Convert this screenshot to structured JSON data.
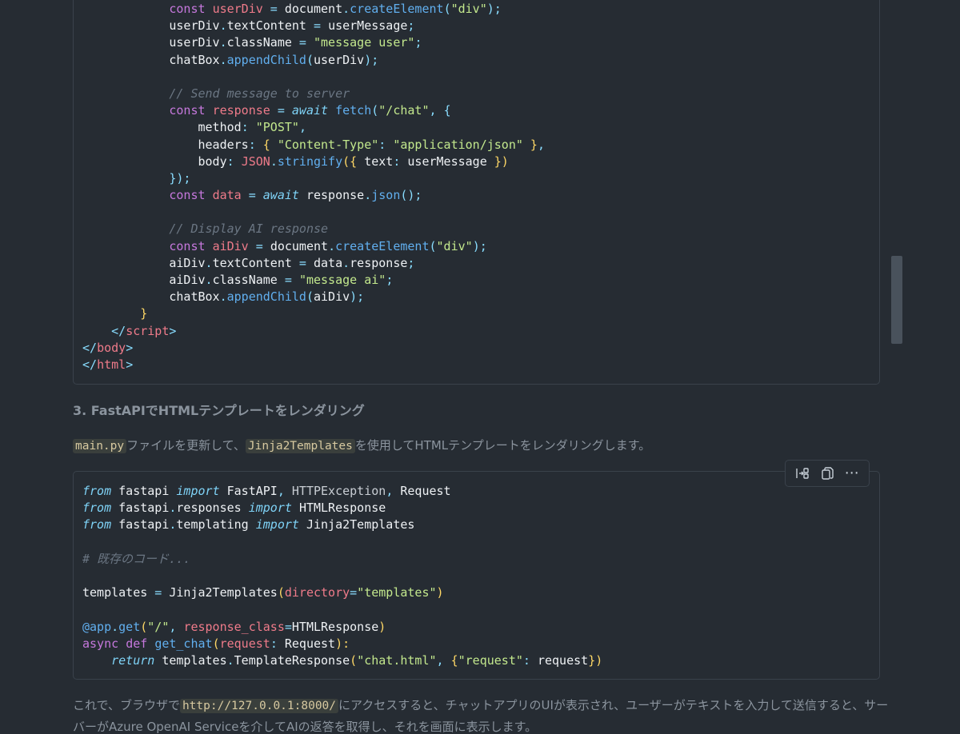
{
  "code_block_1": {
    "lines": [
      [
        [
          "            ",
          "tk-default"
        ],
        [
          "const ",
          "tk-keyword"
        ],
        [
          "userDiv",
          "tk-var"
        ],
        [
          " = ",
          "tk-punct"
        ],
        [
          "document",
          "tk-default"
        ],
        [
          ".",
          "tk-punct"
        ],
        [
          "createElement",
          "tk-func"
        ],
        [
          "(",
          "tk-punct"
        ],
        [
          "\"div\"",
          "tk-string"
        ],
        [
          ");",
          "tk-punct"
        ]
      ],
      [
        [
          "            ",
          "tk-default"
        ],
        [
          "userDiv",
          "tk-default"
        ],
        [
          ".",
          "tk-punct"
        ],
        [
          "textContent",
          "tk-default"
        ],
        [
          " = ",
          "tk-punct"
        ],
        [
          "userMessage",
          "tk-default"
        ],
        [
          ";",
          "tk-punct"
        ]
      ],
      [
        [
          "            ",
          "tk-default"
        ],
        [
          "userDiv",
          "tk-default"
        ],
        [
          ".",
          "tk-punct"
        ],
        [
          "className",
          "tk-default"
        ],
        [
          " = ",
          "tk-punct"
        ],
        [
          "\"message user\"",
          "tk-string"
        ],
        [
          ";",
          "tk-punct"
        ]
      ],
      [
        [
          "            ",
          "tk-default"
        ],
        [
          "chatBox",
          "tk-default"
        ],
        [
          ".",
          "tk-punct"
        ],
        [
          "appendChild",
          "tk-func"
        ],
        [
          "(",
          "tk-punct"
        ],
        [
          "userDiv",
          "tk-default"
        ],
        [
          ");",
          "tk-punct"
        ]
      ],
      [
        [
          "",
          "tk-default"
        ]
      ],
      [
        [
          "            ",
          "tk-default"
        ],
        [
          "// Send message to server",
          "tk-comment"
        ]
      ],
      [
        [
          "            ",
          "tk-default"
        ],
        [
          "const ",
          "tk-keyword"
        ],
        [
          "response",
          "tk-var"
        ],
        [
          " = ",
          "tk-punct"
        ],
        [
          "await ",
          "tk-italic-kw"
        ],
        [
          "fetch",
          "tk-func"
        ],
        [
          "(",
          "tk-punct"
        ],
        [
          "\"/chat\"",
          "tk-string"
        ],
        [
          ", ",
          "tk-punct"
        ],
        [
          "{",
          "tk-punct"
        ]
      ],
      [
        [
          "                ",
          "tk-default"
        ],
        [
          "method",
          "tk-default"
        ],
        [
          ": ",
          "tk-punct"
        ],
        [
          "\"POST\"",
          "tk-string"
        ],
        [
          ",",
          "tk-punct"
        ]
      ],
      [
        [
          "                ",
          "tk-default"
        ],
        [
          "headers",
          "tk-default"
        ],
        [
          ": ",
          "tk-punct"
        ],
        [
          "{ ",
          "tk-brace"
        ],
        [
          "\"Content-Type\"",
          "tk-string"
        ],
        [
          ": ",
          "tk-punct"
        ],
        [
          "\"application/json\"",
          "tk-string"
        ],
        [
          " }",
          "tk-brace"
        ],
        [
          ",",
          "tk-punct"
        ]
      ],
      [
        [
          "                ",
          "tk-default"
        ],
        [
          "body",
          "tk-default"
        ],
        [
          ": ",
          "tk-punct"
        ],
        [
          "JSON",
          "tk-const"
        ],
        [
          ".",
          "tk-punct"
        ],
        [
          "stringify",
          "tk-func"
        ],
        [
          "({ ",
          "tk-brace"
        ],
        [
          "text",
          "tk-default"
        ],
        [
          ": ",
          "tk-punct"
        ],
        [
          "userMessage",
          "tk-default"
        ],
        [
          " })",
          "tk-brace"
        ]
      ],
      [
        [
          "            ",
          "tk-default"
        ],
        [
          "});",
          "tk-punct"
        ]
      ],
      [
        [
          "            ",
          "tk-default"
        ],
        [
          "const ",
          "tk-keyword"
        ],
        [
          "data",
          "tk-var"
        ],
        [
          " = ",
          "tk-punct"
        ],
        [
          "await ",
          "tk-italic-kw"
        ],
        [
          "response",
          "tk-default"
        ],
        [
          ".",
          "tk-punct"
        ],
        [
          "json",
          "tk-func"
        ],
        [
          "();",
          "tk-punct"
        ]
      ],
      [
        [
          "",
          "tk-default"
        ]
      ],
      [
        [
          "            ",
          "tk-default"
        ],
        [
          "// Display AI response",
          "tk-comment"
        ]
      ],
      [
        [
          "            ",
          "tk-default"
        ],
        [
          "const ",
          "tk-keyword"
        ],
        [
          "aiDiv",
          "tk-var"
        ],
        [
          " = ",
          "tk-punct"
        ],
        [
          "document",
          "tk-default"
        ],
        [
          ".",
          "tk-punct"
        ],
        [
          "createElement",
          "tk-func"
        ],
        [
          "(",
          "tk-punct"
        ],
        [
          "\"div\"",
          "tk-string"
        ],
        [
          ");",
          "tk-punct"
        ]
      ],
      [
        [
          "            ",
          "tk-default"
        ],
        [
          "aiDiv",
          "tk-default"
        ],
        [
          ".",
          "tk-punct"
        ],
        [
          "textContent",
          "tk-default"
        ],
        [
          " = ",
          "tk-punct"
        ],
        [
          "data",
          "tk-default"
        ],
        [
          ".",
          "tk-punct"
        ],
        [
          "response",
          "tk-default"
        ],
        [
          ";",
          "tk-punct"
        ]
      ],
      [
        [
          "            ",
          "tk-default"
        ],
        [
          "aiDiv",
          "tk-default"
        ],
        [
          ".",
          "tk-punct"
        ],
        [
          "className",
          "tk-default"
        ],
        [
          " = ",
          "tk-punct"
        ],
        [
          "\"message ai\"",
          "tk-string"
        ],
        [
          ";",
          "tk-punct"
        ]
      ],
      [
        [
          "            ",
          "tk-default"
        ],
        [
          "chatBox",
          "tk-default"
        ],
        [
          ".",
          "tk-punct"
        ],
        [
          "appendChild",
          "tk-func"
        ],
        [
          "(",
          "tk-punct"
        ],
        [
          "aiDiv",
          "tk-default"
        ],
        [
          ");",
          "tk-punct"
        ]
      ],
      [
        [
          "        ",
          "tk-default"
        ],
        [
          "}",
          "tk-brace"
        ]
      ],
      [
        [
          "    ",
          "tk-default"
        ],
        [
          "</",
          "tk-punct"
        ],
        [
          "script",
          "tk-tag"
        ],
        [
          ">",
          "tk-punct"
        ]
      ],
      [
        [
          "",
          "tk-default"
        ],
        [
          "</",
          "tk-punct"
        ],
        [
          "body",
          "tk-tag"
        ],
        [
          ">",
          "tk-punct"
        ]
      ],
      [
        [
          "",
          "tk-default"
        ],
        [
          "</",
          "tk-punct"
        ],
        [
          "html",
          "tk-tag"
        ],
        [
          ">",
          "tk-punct"
        ]
      ]
    ]
  },
  "section_heading": "3. FastAPIでHTMLテンプレートをレンダリング",
  "paragraph_1": {
    "code_1": "main.py",
    "text_1": "ファイルを更新して、",
    "code_2": "Jinja2Templates",
    "text_2": "を使用してHTMLテンプレートをレンダリングします。"
  },
  "toolbar": {
    "wrap_icon": "wrap-lines-icon",
    "copy_icon": "copy-icon",
    "more_icon": "more-icon",
    "more_label": "⋯"
  },
  "code_block_2": {
    "lines": [
      [
        [
          "from ",
          "tk-italic-kw"
        ],
        [
          "fastapi ",
          "tk-default"
        ],
        [
          "import ",
          "tk-italic-kw"
        ],
        [
          "FastAPI",
          "tk-default"
        ],
        [
          ", ",
          "tk-punct"
        ],
        [
          "HTTPException",
          "tk-muted"
        ],
        [
          ", ",
          "tk-punct"
        ],
        [
          "Request",
          "tk-default"
        ]
      ],
      [
        [
          "from ",
          "tk-italic-kw"
        ],
        [
          "fastapi",
          "tk-default"
        ],
        [
          ".",
          "tk-punct"
        ],
        [
          "responses ",
          "tk-default"
        ],
        [
          "import ",
          "tk-italic-kw"
        ],
        [
          "HTMLResponse",
          "tk-default"
        ]
      ],
      [
        [
          "from ",
          "tk-italic-kw"
        ],
        [
          "fastapi",
          "tk-default"
        ],
        [
          ".",
          "tk-punct"
        ],
        [
          "templating ",
          "tk-default"
        ],
        [
          "import ",
          "tk-italic-kw"
        ],
        [
          "Jinja2Templates",
          "tk-default"
        ]
      ],
      [
        [
          "",
          "tk-default"
        ]
      ],
      [
        [
          "# 既存のコード...",
          "tk-comment"
        ]
      ],
      [
        [
          "",
          "tk-default"
        ]
      ],
      [
        [
          "templates",
          "tk-default"
        ],
        [
          " = ",
          "tk-punct"
        ],
        [
          "Jinja2Templates",
          "tk-default"
        ],
        [
          "(",
          "tk-brace"
        ],
        [
          "directory",
          "tk-var"
        ],
        [
          "=",
          "tk-punct"
        ],
        [
          "\"templates\"",
          "tk-string"
        ],
        [
          ")",
          "tk-brace"
        ]
      ],
      [
        [
          "",
          "tk-default"
        ]
      ],
      [
        [
          "@app",
          "tk-func"
        ],
        [
          ".",
          "tk-punct"
        ],
        [
          "get",
          "tk-func"
        ],
        [
          "(",
          "tk-brace"
        ],
        [
          "\"/\"",
          "tk-string"
        ],
        [
          ", ",
          "tk-punct"
        ],
        [
          "response_class",
          "tk-var"
        ],
        [
          "=",
          "tk-punct"
        ],
        [
          "HTMLResponse",
          "tk-default"
        ],
        [
          ")",
          "tk-brace"
        ]
      ],
      [
        [
          "async ",
          "tk-keyword"
        ],
        [
          "def ",
          "tk-keyword"
        ],
        [
          "get_chat",
          "tk-func"
        ],
        [
          "(",
          "tk-brace"
        ],
        [
          "request",
          "tk-var"
        ],
        [
          ": ",
          "tk-punct"
        ],
        [
          "Request",
          "tk-default"
        ],
        [
          "):",
          "tk-brace"
        ]
      ],
      [
        [
          "    ",
          "tk-default"
        ],
        [
          "return ",
          "tk-italic-kw"
        ],
        [
          "templates",
          "tk-default"
        ],
        [
          ".",
          "tk-punct"
        ],
        [
          "TemplateResponse",
          "tk-default"
        ],
        [
          "(",
          "tk-brace"
        ],
        [
          "\"chat.html\"",
          "tk-string"
        ],
        [
          ", ",
          "tk-punct"
        ],
        [
          "{",
          "tk-brace"
        ],
        [
          "\"request\"",
          "tk-string"
        ],
        [
          ": ",
          "tk-punct"
        ],
        [
          "request",
          "tk-default"
        ],
        [
          "})",
          "tk-brace"
        ]
      ]
    ]
  },
  "paragraph_2": {
    "text_1": "これで、ブラウザで",
    "code_1": "http://127.0.0.1:8000/",
    "text_2": "にアクセスすると、チャットアプリのUIが表示され、ユーザーがテキストを入力して送信すると、サーバーがAzure OpenAI Serviceを介してAIの返答を取得し、それを画面に表示します。"
  }
}
